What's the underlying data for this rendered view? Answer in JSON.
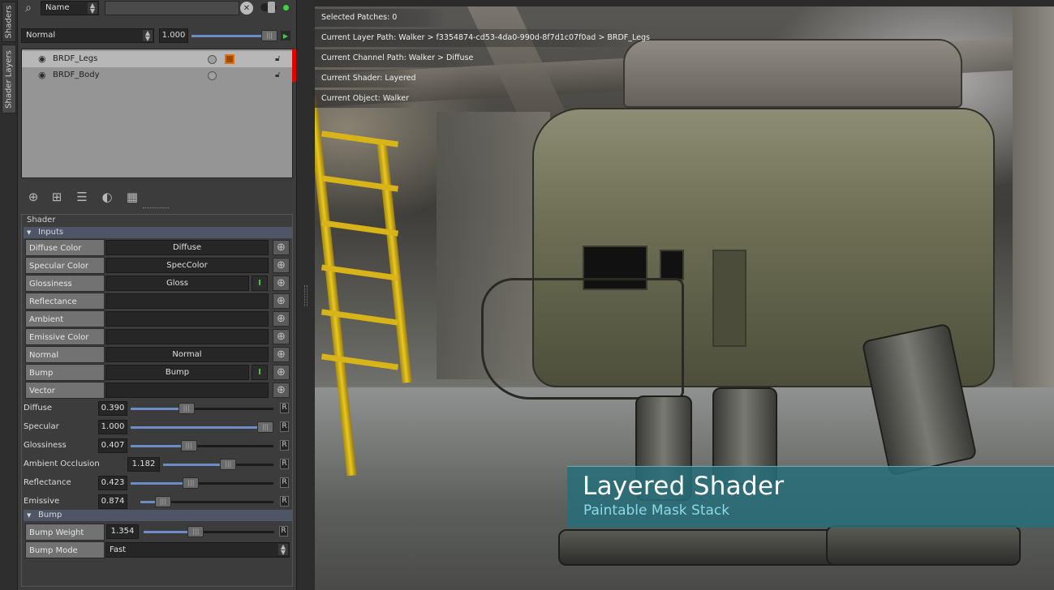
{
  "vertical_tabs": [
    {
      "label": "Shaders",
      "active": false
    },
    {
      "label": "Shader Layers",
      "active": true
    }
  ],
  "toolbar": {
    "filter_field": "Name",
    "search_value": "",
    "icons": [
      "search-icon",
      "clear-icon",
      "toggle-icon",
      "status-dot-icon"
    ]
  },
  "blend": {
    "mode": "Normal",
    "opacity": "1.000",
    "opacity_fraction": 0.95
  },
  "layers": [
    {
      "name": "BRDF_Legs",
      "selected": true
    },
    {
      "name": "BRDF_Body",
      "selected": false
    }
  ],
  "layer_tools": [
    "add-layer-icon",
    "add-mask-icon",
    "add-group-icon",
    "copy-layer-icon",
    "grid-icon"
  ],
  "shader": {
    "title": "Shader",
    "inputs_group": "Inputs",
    "inputs": [
      {
        "label": "Diffuse Color",
        "value": "Diffuse",
        "has_toggle": false
      },
      {
        "label": "Specular Color",
        "value": "SpecColor",
        "has_toggle": false
      },
      {
        "label": "Glossiness",
        "value": "Gloss",
        "has_toggle": true
      },
      {
        "label": "Reflectance",
        "value": "",
        "has_toggle": false
      },
      {
        "label": "Ambient Occlusion",
        "value": "",
        "has_toggle": false
      },
      {
        "label": "Emissive Color",
        "value": "",
        "has_toggle": false
      },
      {
        "label": "Normal",
        "value": "Normal",
        "has_toggle": false
      },
      {
        "label": "Bump",
        "value": "Bump",
        "has_toggle": true
      },
      {
        "label": "Vector",
        "value": "",
        "has_toggle": false
      }
    ],
    "toggle_glyph": "I",
    "reset_glyph": "R",
    "sliders": [
      {
        "label": "Diffuse",
        "value": "0.390",
        "fraction": 0.39
      },
      {
        "label": "Specular",
        "value": "1.000",
        "fraction": 1.0
      },
      {
        "label": "Glossiness",
        "value": "0.407",
        "fraction": 0.407
      },
      {
        "label": "Ambient Occlusion",
        "value": "1.182",
        "fraction": 0.59
      },
      {
        "label": "Reflectance",
        "value": "0.423",
        "fraction": 0.423
      },
      {
        "label": "Emissive",
        "value": "0.874",
        "fraction": 0.17
      }
    ],
    "bump_group": "Bump",
    "bump_weight": {
      "label": "Bump Weight",
      "value": "1.354",
      "fraction": 0.4
    },
    "bump_mode": {
      "label": "Bump Mode",
      "value": "Fast"
    }
  },
  "viewport": {
    "info": [
      "Selected Patches: 0",
      "Current Layer Path: Walker > f3354874-cd53-4da0-990d-8f7d1c07f0ad > BRDF_Legs",
      "Current Channel Path: Walker > Diffuse",
      "Current Shader: Layered",
      "Current Object: Walker"
    ],
    "banner_title": "Layered Shader",
    "banner_subtitle": "Paintable Mask Stack"
  }
}
